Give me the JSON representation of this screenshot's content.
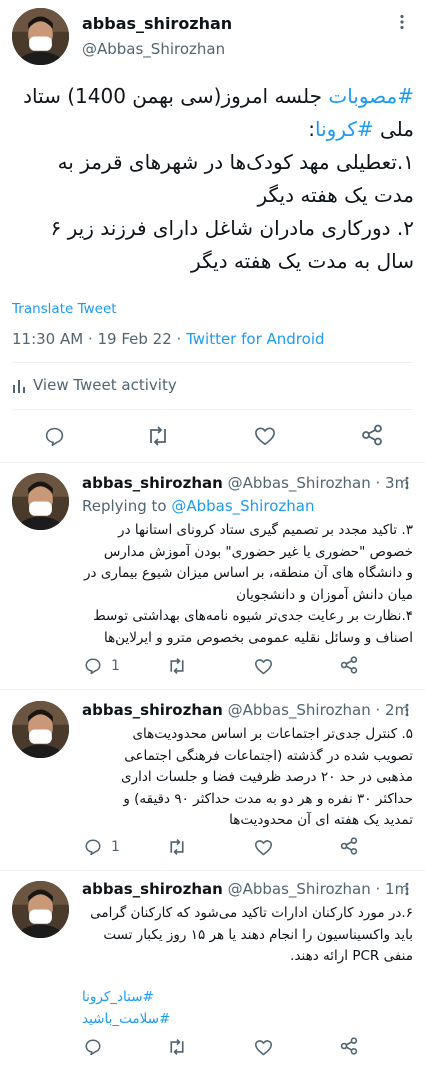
{
  "main_tweet": {
    "display_name": "abbas_shirozhan",
    "handle": "@Abbas_Shirozhan",
    "line1_hashtag": "#مصوبات",
    "line1_text": " جلسه امروز(سی بهمن 1400) ستاد",
    "line2_text": "ملی ",
    "line2_hashtag": "#کرونا",
    "line2_colon": ":",
    "line3": "۱.تعطیلی مهد کودک‌ها در شهرهای قرمز به",
    "line4": "مدت یک هفته دیگر",
    "line5": "۲. دورکاری مادران شاغل دارای فرزند زیر ۶",
    "line6": "سال به مدت یک هفته دیگر",
    "translate_label": "Translate Tweet",
    "timestamp": "11:30 AM · 19 Feb 22 · ",
    "source": "Twitter for Android",
    "activity_label": "View Tweet activity"
  },
  "replies": [
    {
      "display_name": "abbas_shirozhan",
      "handle": "@Abbas_Shirozhan",
      "time": "· 3m",
      "replying_prefix": "Replying to ",
      "replying_handle": "@Abbas_Shirozhan",
      "lines": [
        "۳. تاکید مجدد بر تصمیم گیری ستاد کرونای استانها در",
        "خصوص \"حضوری یا غیر حضوری\" بودن آموزش مدارس",
        "و دانشگاه های آن منطقه، بر اساس میزان شیوع بیماری در",
        "میان دانش آموزان و دانشجویان",
        "۴.نظارت بر رعایت جدی‌تر شیوه نامه‌های بهداشتی توسط",
        "اصناف و وسائل نقلیه عمومی بخصوص مترو و ایرلاین‌ها"
      ],
      "reply_count": "1"
    },
    {
      "display_name": "abbas_shirozhan",
      "handle": "@Abbas_Shirozhan",
      "time": "· 2m",
      "lines": [
        "۵. کنترل جدی‌تر اجتماعات بر اساس محدودیت‌های",
        "تصویب شده در گذشته (اجتماعات فرهنگی اجتماعی",
        "مذهبی در حد ۲۰ درصد ظرفیت فضا و جلسات اداری",
        "حداکثر ۳۰ نفره و هر دو به مدت حداکثر ۹۰ دقیقه) و",
        "تمدید یک هفته ای آن محدودیت‌ها"
      ],
      "reply_count": "1"
    },
    {
      "display_name": "abbas_shirozhan",
      "handle": "@Abbas_Shirozhan",
      "time": "· 1m",
      "lines": [
        "۶.در مورد کارکنان ادارات تاکید می‌شود که کارکنان گرامی",
        "باید واکسیناسیون را انجام دهند یا هر ۱۵ روز یکبار تست",
        "منفی PCR ارائه دهند."
      ],
      "hashtag1": "#ستاد_کرونا",
      "hashtag2": "#سلامت_باشید"
    }
  ],
  "colors": {
    "accent": "#1d9bf0",
    "secondary_text": "#536471",
    "divider": "#eff3f4"
  },
  "icons": [
    "more-icon",
    "bar-chart-icon",
    "reply-icon",
    "retweet-icon",
    "like-icon",
    "share-icon",
    "mask-avatar"
  ]
}
